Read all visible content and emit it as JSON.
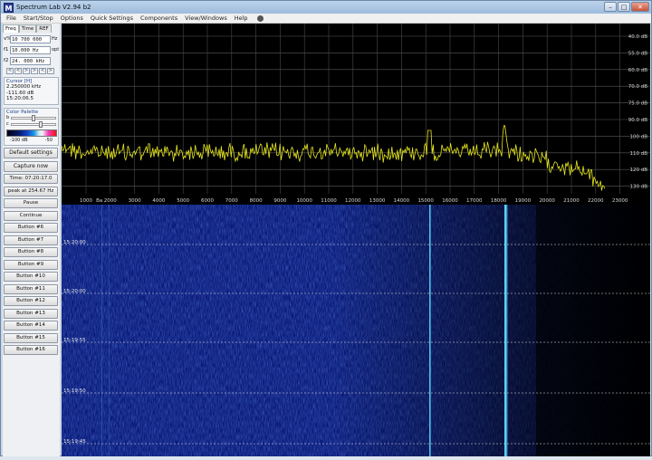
{
  "window": {
    "title": "Spectrum Lab V2.94 b2",
    "app_icon": "spectrum-lab-icon",
    "controls": [
      "–",
      "□",
      "✕"
    ]
  },
  "menu": [
    "File",
    "Start/Stop",
    "Options",
    "Quick Settings",
    "Components",
    "View/Windows",
    "Help"
  ],
  "sidebar": {
    "tabs": [
      "Freq",
      "Time",
      "REF"
    ],
    "fields": [
      {
        "label": "v%",
        "value": "10 700 000",
        "unit": "Hz"
      },
      {
        "label": "f1",
        "value": "10.000 Hz",
        "unit": "opt"
      },
      {
        "label": "f2",
        "value": "24. 000 kHz",
        "unit": ""
      }
    ],
    "arrows": [
      "<",
      "<",
      ">",
      ">",
      "<",
      ">"
    ],
    "cursor": {
      "title": "Cursor [H]",
      "lines": [
        "2.250000 kHz",
        "-111.60 dB",
        "15:20:06.5"
      ]
    },
    "color_palette": {
      "title": "Color Palette",
      "slider_b": "b",
      "slider_c": "c",
      "min_label": "-100 dB",
      "max_label": "-50"
    },
    "buttons_top": [
      "Default settings",
      "Capture now"
    ],
    "time_label": "Time:  07:20:17.0",
    "peak_label": "peak at 254.67 Hz",
    "buttons_bottom": [
      "Pause",
      "Continue",
      "Button #6",
      "Button #7",
      "Button #8",
      "Button #9",
      "Button #10",
      "Button #11",
      "Button #12",
      "Button #13",
      "Button #14",
      "Button #15",
      "Button #16"
    ]
  },
  "spectrum": {
    "db_labels": [
      "40.0 dB",
      "55.0 dB",
      "60.0 dB",
      "70.0 dB",
      "75.0 dB",
      "90.0 dB",
      "100 dB",
      "110 dB",
      "120 dB",
      "130 dB"
    ],
    "freq_labels": [
      "1000",
      "Ba",
      "2000",
      "3000",
      "4000",
      "5000",
      "6000",
      "7000",
      "8000",
      "9000",
      "10000",
      "11000",
      "12000",
      "13000",
      "14000",
      "15000",
      "16000",
      "17000",
      "18000",
      "19000",
      "20000",
      "21000",
      "22000",
      "23000"
    ],
    "trace_color": "#e6e61e"
  },
  "waterfall": {
    "timestamps": [
      "15:20:00",
      "15:20:00",
      "15:19:55",
      "15:19:50",
      "15:19:45"
    ],
    "marker_color": "#5ad2ff"
  }
}
